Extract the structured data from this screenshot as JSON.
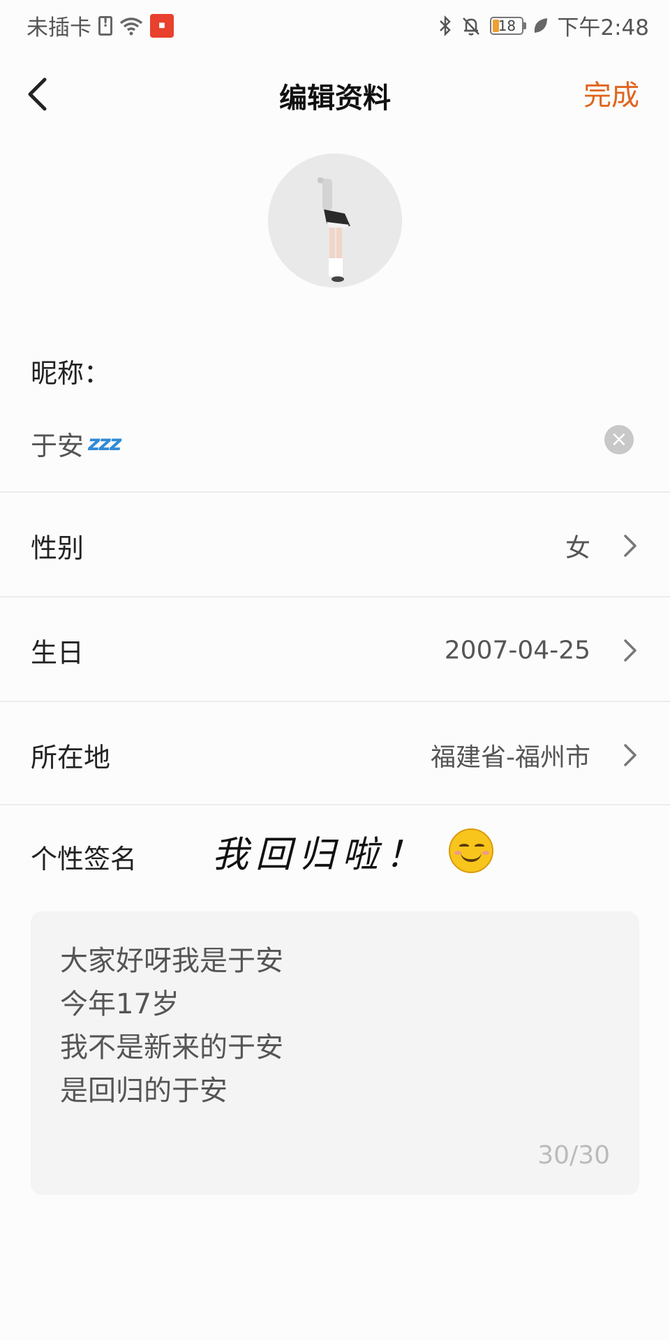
{
  "status_bar": {
    "carrier": "未插卡",
    "battery_level": "18",
    "time": "下午2:48",
    "icons": [
      "sim-alert-icon",
      "wifi-icon",
      "app-badge-icon",
      "bluetooth-icon",
      "bell-off-icon",
      "battery-icon",
      "leaf-icon"
    ]
  },
  "header": {
    "title": "编辑资料",
    "done_label": "完成",
    "back_icon": "chevron-left-icon"
  },
  "profile": {
    "nickname_label": "昵称：",
    "nickname_value": "于安",
    "nickname_emoji": "zzz",
    "fields": [
      {
        "label": "性别",
        "value": "女"
      },
      {
        "label": "生日",
        "value": "2007-04-25"
      },
      {
        "label": "所在地",
        "value": "福建省-福州市"
      }
    ],
    "signature_label": "个性签名",
    "signature_overlay": "我回归啦！",
    "signature_lines": [
      "大家好呀我是于安",
      "今年17岁",
      "我不是新来的于安",
      "是回归的于安"
    ],
    "signature_counter": "30/30"
  },
  "colors": {
    "accent": "#e0651e",
    "background": "#fcfcfc",
    "divider": "#ececec",
    "text_box": "#f4f4f4"
  }
}
